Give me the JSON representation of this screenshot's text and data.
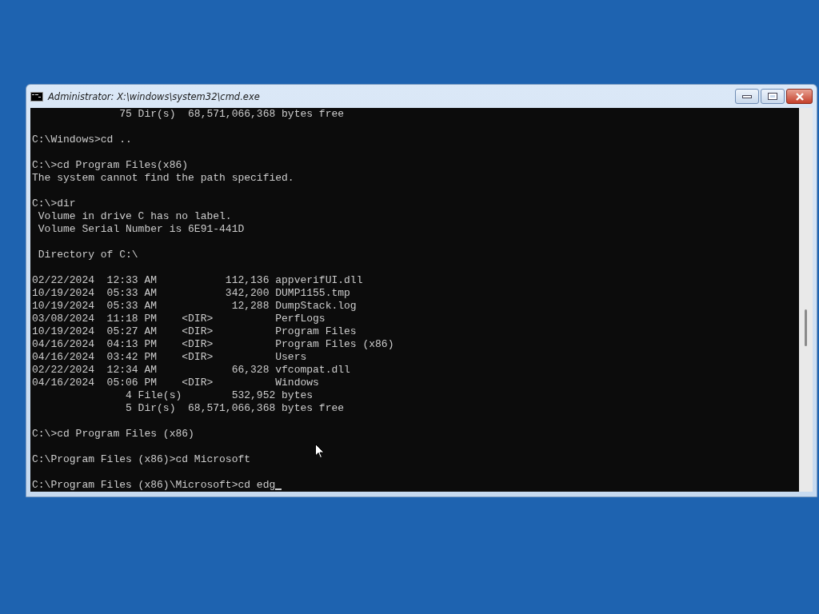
{
  "window": {
    "title": "Administrator: X:\\windows\\system32\\cmd.exe"
  },
  "console": {
    "blocks": [
      {
        "lines": [
          "              75 Dir(s)  68,571,066,368 bytes free"
        ]
      },
      {
        "lines": [
          "C:\\Windows>cd .."
        ]
      },
      {
        "lines": [
          "C:\\>cd Program Files(x86)",
          "The system cannot find the path specified."
        ]
      },
      {
        "lines": [
          "C:\\>dir",
          " Volume in drive C has no label.",
          " Volume Serial Number is 6E91-441D"
        ]
      },
      {
        "lines": [
          " Directory of C:\\"
        ]
      },
      {
        "lines": [
          "02/22/2024  12:33 AM           112,136 appverifUI.dll",
          "10/19/2024  05:33 AM           342,200 DUMP1155.tmp",
          "10/19/2024  05:33 AM            12,288 DumpStack.log",
          "03/08/2024  11:18 PM    <DIR>          PerfLogs",
          "10/19/2024  05:27 AM    <DIR>          Program Files",
          "04/16/2024  04:13 PM    <DIR>          Program Files (x86)",
          "04/16/2024  03:42 PM    <DIR>          Users",
          "02/22/2024  12:34 AM            66,328 vfcompat.dll",
          "04/16/2024  05:06 PM    <DIR>          Windows",
          "               4 File(s)        532,952 bytes",
          "               5 Dir(s)  68,571,066,368 bytes free"
        ]
      },
      {
        "lines": [
          "C:\\>cd Program Files (x86)"
        ]
      },
      {
        "lines": [
          "C:\\Program Files (x86)>cd Microsoft"
        ]
      },
      {
        "lines": [
          "C:\\Program Files (x86)\\Microsoft>cd edg"
        ]
      }
    ]
  }
}
